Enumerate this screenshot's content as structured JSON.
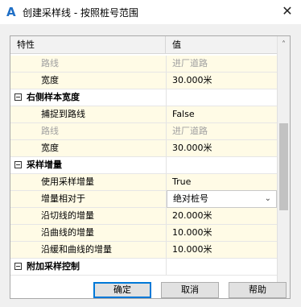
{
  "window": {
    "title": "创建采样线 - 按照桩号范围",
    "app_icon": "autocad-civil-a-icon",
    "close_glyph": "✕"
  },
  "grid": {
    "header": {
      "property": "特性",
      "value": "值"
    },
    "rows": [
      {
        "kind": "item",
        "label": "路线",
        "value": "进厂道路",
        "disabled": true
      },
      {
        "kind": "item",
        "label": "宽度",
        "value": "30.000米"
      },
      {
        "kind": "cat",
        "label": "右侧样本宽度",
        "value": ""
      },
      {
        "kind": "item",
        "label": "捕捉到路线",
        "value": "False"
      },
      {
        "kind": "item",
        "label": "路线",
        "value": "进厂道路",
        "disabled": true
      },
      {
        "kind": "item",
        "label": "宽度",
        "value": "30.000米"
      },
      {
        "kind": "cat",
        "label": "采样增量",
        "value": ""
      },
      {
        "kind": "item",
        "label": "使用采样增量",
        "value": "True"
      },
      {
        "kind": "item",
        "label": "增量相对于",
        "value": "绝对桩号",
        "combo": true
      },
      {
        "kind": "item",
        "label": "沿切线的增量",
        "value": "20.000米"
      },
      {
        "kind": "item",
        "label": "沿曲线的增量",
        "value": "10.000米"
      },
      {
        "kind": "item",
        "label": "沿缓和曲线的增量",
        "value": "10.000米"
      },
      {
        "kind": "cat",
        "label": "附加采样控制",
        "value": ""
      }
    ],
    "scroll_up_glyph": "˄",
    "scroll_down_glyph": "˅",
    "combo_arrow_glyph": "⌄"
  },
  "buttons": {
    "ok": "确定",
    "cancel": "取消",
    "help": "帮助"
  },
  "colors": {
    "item_background": "#fffbe6",
    "disabled_text": "#a0a0a0",
    "default_button_border": "#0078d7"
  }
}
